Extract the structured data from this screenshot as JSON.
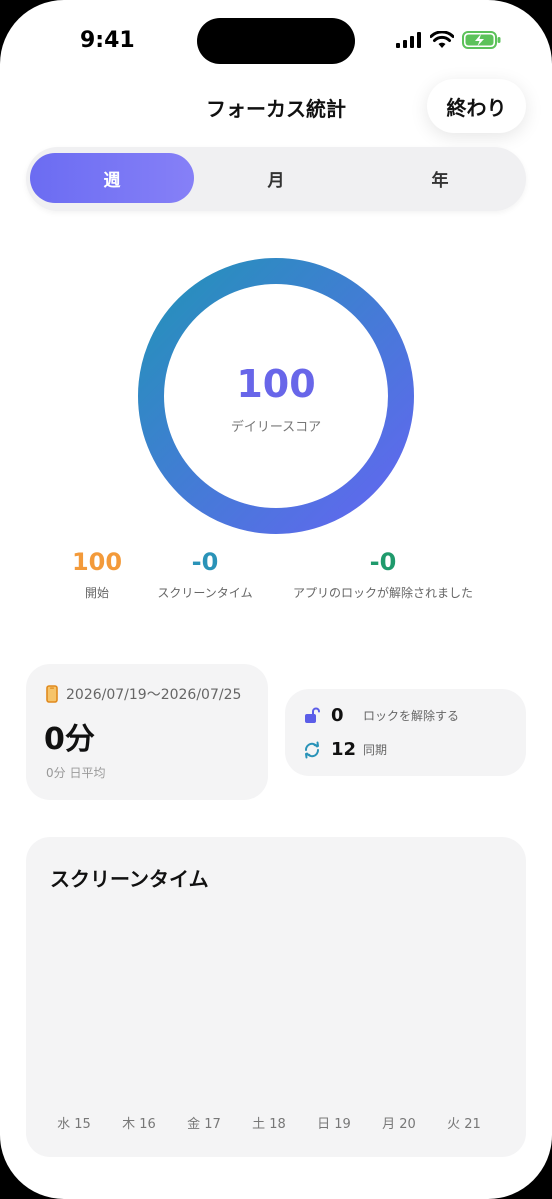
{
  "status": {
    "time": "9:41"
  },
  "header": {
    "title": "フォーカス統計",
    "done_label": "終わり"
  },
  "tabs": [
    {
      "label": "週",
      "active": true
    },
    {
      "label": "月",
      "active": false
    },
    {
      "label": "年",
      "active": false
    }
  ],
  "score": {
    "value": "100",
    "label": "デイリースコア",
    "progress": 1.0
  },
  "stats": [
    {
      "value": "100",
      "label": "開始",
      "color": "#f39a3a"
    },
    {
      "value": "-0",
      "label": "スクリーンタイム",
      "color": "#2a93b8"
    },
    {
      "value": "-0",
      "label": "アプリのロックが解除されました",
      "color": "#1f9a6c"
    }
  ],
  "summary": {
    "date_range": "2026/07/19～2026/07/25",
    "total": "0分",
    "daily_avg": "0分 日平均"
  },
  "mini_stats": [
    {
      "icon": "unlock-icon",
      "value": "0",
      "label": "ロックを解除する"
    },
    {
      "icon": "sync-icon",
      "value": "12",
      "label": "同期"
    }
  ],
  "chart_data": {
    "type": "bar",
    "title": "スクリーンタイム",
    "categories": [
      "水 15",
      "木 16",
      "金 17",
      "土 18",
      "日 19",
      "月 20",
      "火 21"
    ],
    "values": [
      0,
      0,
      0,
      0,
      0,
      0,
      0
    ]
  },
  "colors": {
    "accent": "#6b6cf2",
    "ring_start": "#6366f1",
    "ring_end": "#2392b9"
  }
}
